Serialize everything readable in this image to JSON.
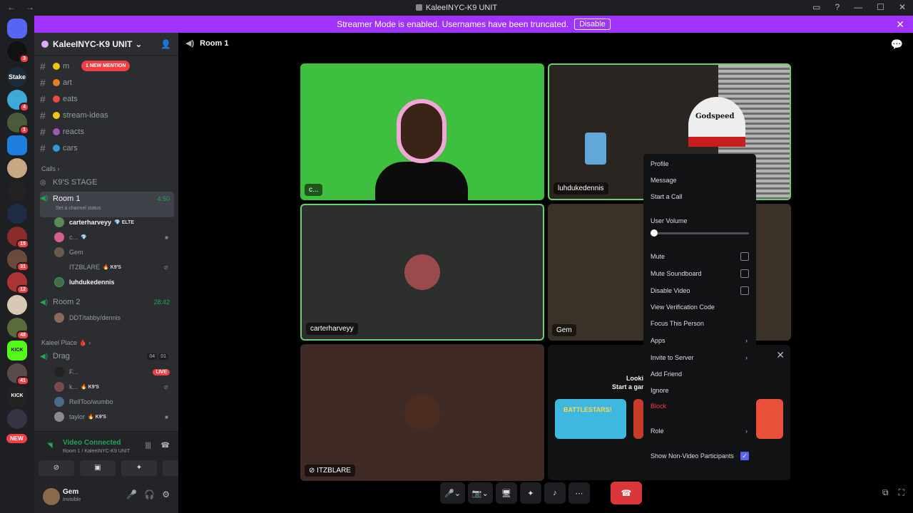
{
  "window": {
    "title": "KaleeINYC-K9 UNIT",
    "nav_back": "←",
    "nav_fwd": "→",
    "controls": [
      "▭",
      "?",
      "—",
      "☐",
      "✕"
    ]
  },
  "banner": {
    "text": "Streamer Mode is enabled. Usernames have been truncated.",
    "button": "Disable",
    "close": "✕",
    "color": "#a033ff"
  },
  "guilds": {
    "badges": [
      "3",
      "4",
      "1",
      "15",
      "31",
      "12",
      "48",
      "41"
    ],
    "new_label": "NEW",
    "stake_label": "Stake",
    "kick_label": "KICK",
    "kick2_label": "KICK"
  },
  "server": {
    "name": "KaleeINYC-K9 UNIT",
    "chevron": "⌄",
    "invite_icon": "👤"
  },
  "channels": [
    {
      "name": "m",
      "emoji_color": "#f1c40f"
    },
    {
      "name": "art",
      "emoji_color": "#e67e22"
    },
    {
      "name": "eats",
      "emoji_color": "#e74c3c"
    },
    {
      "name": "stream-ideas",
      "emoji_color": "#f1c40f"
    },
    {
      "name": "reacts",
      "emoji_color": "#9b59b6"
    },
    {
      "name": "cars",
      "emoji_color": "#3498db"
    }
  ],
  "mention_pill": "1 NEW MENTION",
  "calls_category": "Calls",
  "stage": "K9'S STAGE",
  "room1": {
    "name": "Room 1",
    "time": "4:50",
    "status": "Set a channel status"
  },
  "room1_members": [
    {
      "name": "carterharveyy",
      "tag": "💎 ELTE",
      "bold": true
    },
    {
      "name": "c...",
      "tag": "💎",
      "bold": false
    },
    {
      "name": "Gem",
      "tag": "",
      "bold": false
    },
    {
      "name": "ITZBLARE",
      "tag": "🔥 K9'S",
      "bold": false
    },
    {
      "name": "luhdukedennis",
      "tag": "",
      "bold": true
    }
  ],
  "room2": {
    "name": "Room 2",
    "time": "28:42",
    "member": "DDT/tabby/dennis"
  },
  "category2": "Kaleel Place 🩸",
  "drag": {
    "name": "Drag",
    "count_a": "04",
    "count_b": "01"
  },
  "drag_members": [
    {
      "name": "F...",
      "live": "LIVE"
    },
    {
      "name": "k...",
      "tag": "🔥 K9'S"
    },
    {
      "name": "RellToo/wumbo"
    },
    {
      "name": "taylor",
      "tag": "🔥 K9'S"
    }
  ],
  "voice": {
    "status": "Video Connected",
    "location": "Room 1 / KaleeINYC-K9 UNIT"
  },
  "user": {
    "name": "Gem",
    "status": "Invisible"
  },
  "room_header": "Room 1",
  "tiles": {
    "t1": "c...",
    "t2": "luhdukedennis",
    "t3": "carterharveyy",
    "t4": "Gem",
    "t5": "ITZBLARE"
  },
  "cap_text": "Godspeed",
  "activity": {
    "line1": "Looki",
    "line2": "Start a gam",
    "game1": "BATTLESTARS!",
    "close": "✕"
  },
  "context_menu": {
    "profile": "Profile",
    "message": "Message",
    "start_call": "Start a Call",
    "user_volume": "User Volume",
    "mute": "Mute",
    "mute_soundboard": "Mute Soundboard",
    "disable_video": "Disable Video",
    "verification": "View Verification Code",
    "focus": "Focus This Person",
    "apps": "Apps",
    "invite": "Invite to Server",
    "add_friend": "Add Friend",
    "ignore": "Ignore",
    "block": "Block",
    "role": "Role",
    "show_nonvideo": "Show Non-Video Participants",
    "volume_value": 0,
    "show_nonvideo_checked": true
  },
  "bottom_controls": {
    "mic": "🎤",
    "cam": "📷",
    "share": "🖥",
    "activity": "✦",
    "soundboard": "♪",
    "more": "⋯",
    "hangup": "☎"
  }
}
